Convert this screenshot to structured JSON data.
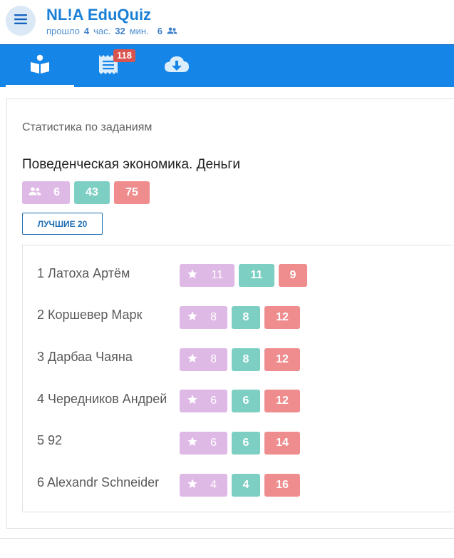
{
  "header": {
    "title": "NL!A EduQuiz",
    "elapsed_prefix": "прошло",
    "elapsed_hours": "4",
    "elapsed_hours_unit": "час.",
    "elapsed_minutes": "32",
    "elapsed_minutes_unit": "мин.",
    "participants_count": "6",
    "menu_icon": "hamburger-menu-icon",
    "participants_icon": "people-icon"
  },
  "tabs": [
    {
      "icon": "open-book-icon",
      "active": true
    },
    {
      "icon": "receipt-list-icon",
      "badge": "118",
      "active": false
    },
    {
      "icon": "cloud-download-icon",
      "active": false
    }
  ],
  "stats": {
    "header": "Статистика по заданиям",
    "quiz_title": "Поведенческая экономика. Деньги",
    "participants": "6",
    "correct": "43",
    "wrong": "75",
    "best_button": "ЛУЧШИЕ 20"
  },
  "leaderboard": [
    {
      "name": "1 Латоха Артём",
      "stars": "11",
      "correct": "11",
      "wrong": "9"
    },
    {
      "name": "2 Коршевер Марк",
      "stars": "8",
      "correct": "8",
      "wrong": "12"
    },
    {
      "name": "3 Дарбаа Чаяна",
      "stars": "8",
      "correct": "8",
      "wrong": "12"
    },
    {
      "name": "4 Чередников Андрей",
      "stars": "6",
      "correct": "6",
      "wrong": "12"
    },
    {
      "name": "5 92",
      "stars": "6",
      "correct": "6",
      "wrong": "14"
    },
    {
      "name": "6 Alexandr Schneider",
      "stars": "4",
      "correct": "4",
      "wrong": "16"
    }
  ],
  "colors": {
    "brand": "#1586e8",
    "title": "#1a7fd6",
    "stars_pill": "#dfb9e6",
    "correct_pill": "#7dcfc3",
    "wrong_pill": "#ef8c8e",
    "badge": "#d9534f"
  }
}
